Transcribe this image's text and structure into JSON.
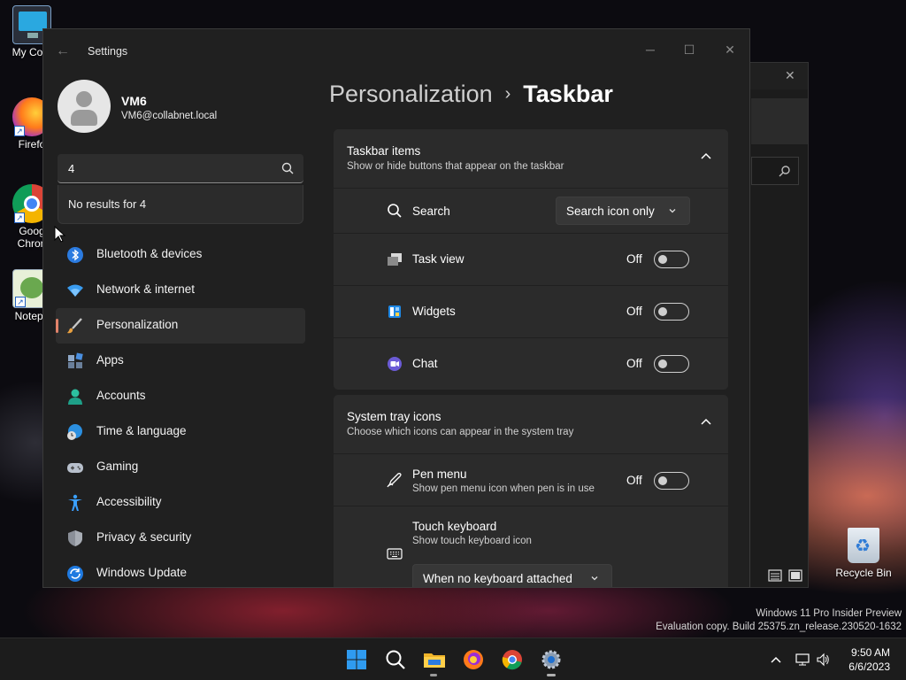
{
  "desktop": {
    "icons": [
      {
        "label": "My Com"
      },
      {
        "label": "Firefo"
      },
      {
        "label": "Goog\nChron"
      },
      {
        "label": "Notepa"
      }
    ],
    "recycle_bin_label": "Recycle Bin",
    "watermark": {
      "line1": "Windows 11 Pro Insider Preview",
      "line2": "Evaluation copy. Build 25375.zn_release.230520-1632"
    }
  },
  "settings": {
    "title": "Settings",
    "user": {
      "name": "VM6",
      "email": "VM6@collabnet.local"
    },
    "search": {
      "value": "4",
      "no_results": "No results for 4"
    },
    "nav": [
      {
        "label": "Bluetooth & devices",
        "icon": "bluetooth-icon"
      },
      {
        "label": "Network & internet",
        "icon": "wifi-icon"
      },
      {
        "label": "Personalization",
        "icon": "brush-icon",
        "active": true
      },
      {
        "label": "Apps",
        "icon": "apps-icon"
      },
      {
        "label": "Accounts",
        "icon": "person-icon"
      },
      {
        "label": "Time & language",
        "icon": "globe-clock-icon"
      },
      {
        "label": "Gaming",
        "icon": "gamepad-icon"
      },
      {
        "label": "Accessibility",
        "icon": "accessibility-icon"
      },
      {
        "label": "Privacy & security",
        "icon": "shield-icon"
      },
      {
        "label": "Windows Update",
        "icon": "update-icon"
      }
    ],
    "breadcrumb": {
      "parent": "Personalization",
      "separator": "›",
      "current": "Taskbar"
    },
    "taskbar_items": {
      "title": "Taskbar items",
      "subtitle": "Show or hide buttons that appear on the taskbar",
      "search": {
        "label": "Search",
        "value": "Search icon only"
      },
      "task_view": {
        "label": "Task view",
        "state": "Off"
      },
      "widgets": {
        "label": "Widgets",
        "state": "Off"
      },
      "chat": {
        "label": "Chat",
        "state": "Off"
      }
    },
    "system_tray": {
      "title": "System tray icons",
      "subtitle": "Choose which icons can appear in the system tray",
      "pen_menu": {
        "label": "Pen menu",
        "sub": "Show pen menu icon when pen is in use",
        "state": "Off"
      },
      "touch_keyboard": {
        "label": "Touch keyboard",
        "sub": "Show touch keyboard icon",
        "value": "When no keyboard attached"
      }
    }
  },
  "taskbar": {
    "time": "9:50 AM",
    "date": "6/6/2023"
  },
  "colors": {
    "accent": "#e0826a",
    "window_bg": "#202020",
    "card_bg": "#2b2b2b"
  }
}
